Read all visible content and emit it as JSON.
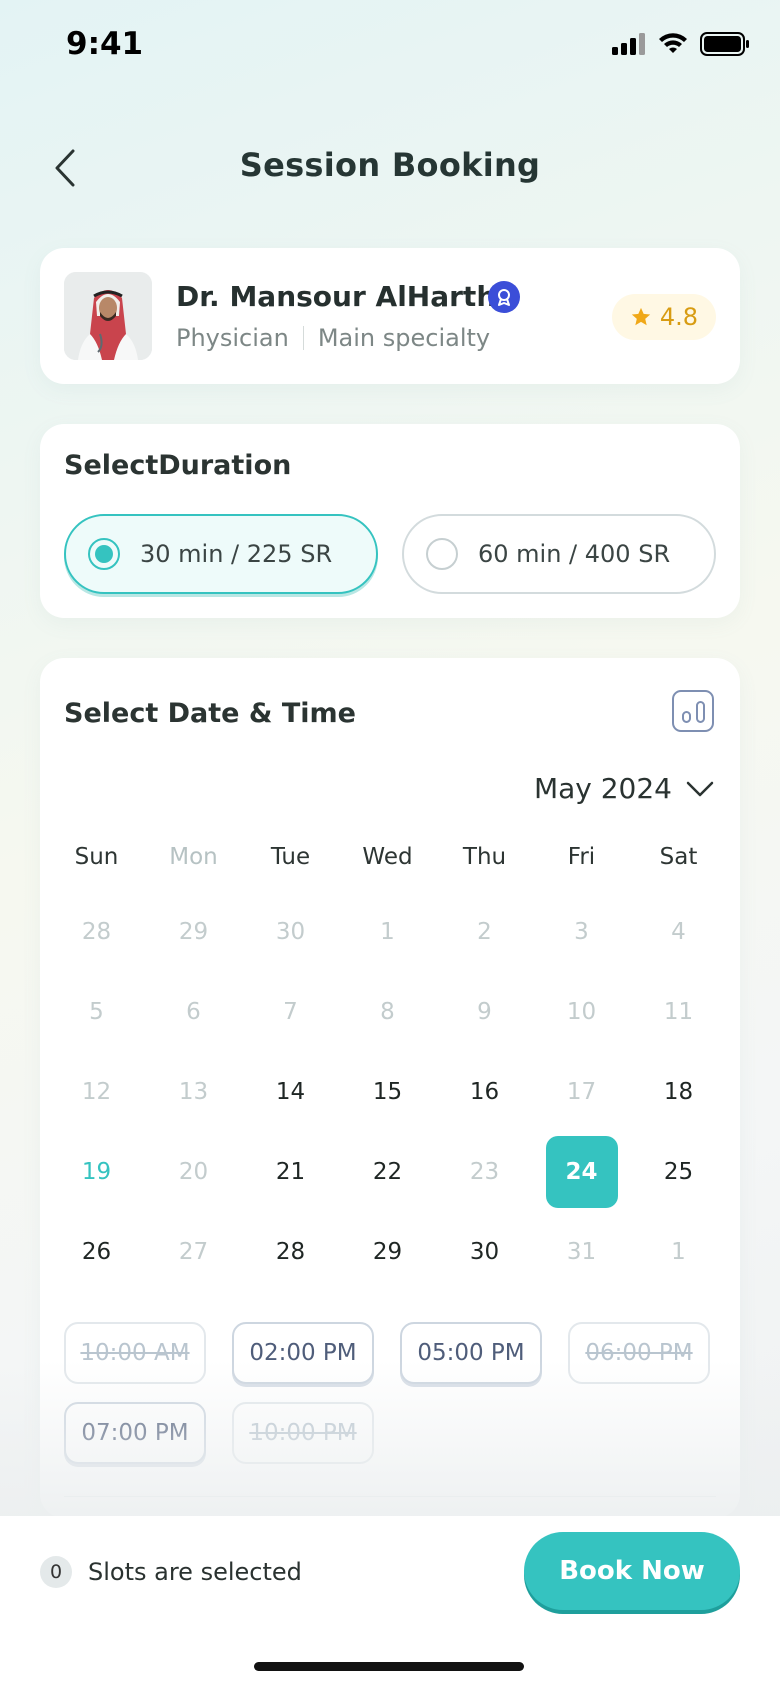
{
  "status_bar": {
    "time": "9:41"
  },
  "header": {
    "title": "Session Booking"
  },
  "doctor": {
    "name": "Dr. Mansour AlHarthi",
    "role": "Physician",
    "specialty": "Main specialty",
    "rating": "4.8"
  },
  "duration": {
    "title": "SelectDuration",
    "options": [
      {
        "label": "30 min / 225 SR",
        "selected": true
      },
      {
        "label": "60 min / 400 SR",
        "selected": false
      }
    ]
  },
  "calendar": {
    "title": "Select Date & Time",
    "month": "May 2024",
    "weekdays": [
      "Sun",
      "Mon",
      "Tue",
      "Wed",
      "Thu",
      "Fri",
      "Sat"
    ],
    "weeks": [
      [
        "28",
        "29",
        "30",
        "1",
        "2",
        "3",
        "4"
      ],
      [
        "5",
        "6",
        "7",
        "8",
        "9",
        "10",
        "11"
      ],
      [
        "12",
        "13",
        "14",
        "15",
        "16",
        "17",
        "18"
      ],
      [
        "19",
        "20",
        "21",
        "22",
        "23",
        "24",
        "25"
      ],
      [
        "26",
        "27",
        "28",
        "29",
        "30",
        "31",
        "1"
      ]
    ],
    "selected_day": "24",
    "today": "19"
  },
  "time_slots": [
    {
      "label": "10:00 AM",
      "available": false
    },
    {
      "label": "02:00 PM",
      "available": true
    },
    {
      "label": "05:00 PM",
      "available": true
    },
    {
      "label": "06:00 PM",
      "available": false
    },
    {
      "label": "07:00 PM",
      "available": true
    },
    {
      "label": "10:00 PM",
      "available": false
    }
  ],
  "footer": {
    "selected_count": "0",
    "selected_label": "Slots are selected",
    "book_button": "Book Now"
  },
  "colors": {
    "accent": "#35c3c0",
    "rating": "#d89c12",
    "verified": "#3b4ed8"
  }
}
